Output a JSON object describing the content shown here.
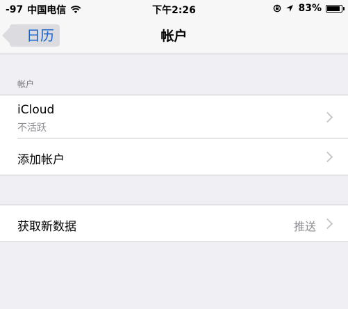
{
  "status_bar": {
    "signal": "-97",
    "carrier": "中国电信",
    "time": "下午2:26",
    "battery": "83%"
  },
  "nav": {
    "back_label": "日历",
    "title": "帐户"
  },
  "accounts_section": {
    "header": "帐户",
    "items": [
      {
        "label": "iCloud",
        "sublabel": "不活跃"
      },
      {
        "label": "添加帐户"
      }
    ]
  },
  "fetch_section": {
    "label": "获取新数据",
    "value": "推送"
  },
  "colors": {
    "accent": "#1a63c9",
    "background": "#efeff4",
    "separator": "#c8c7cc",
    "secondary_text": "#8e8e93"
  },
  "icons": [
    "wifi-icon",
    "rotation-lock-icon",
    "location-icon",
    "battery-icon",
    "back-chevron-icon",
    "chevron-right-icon"
  ]
}
